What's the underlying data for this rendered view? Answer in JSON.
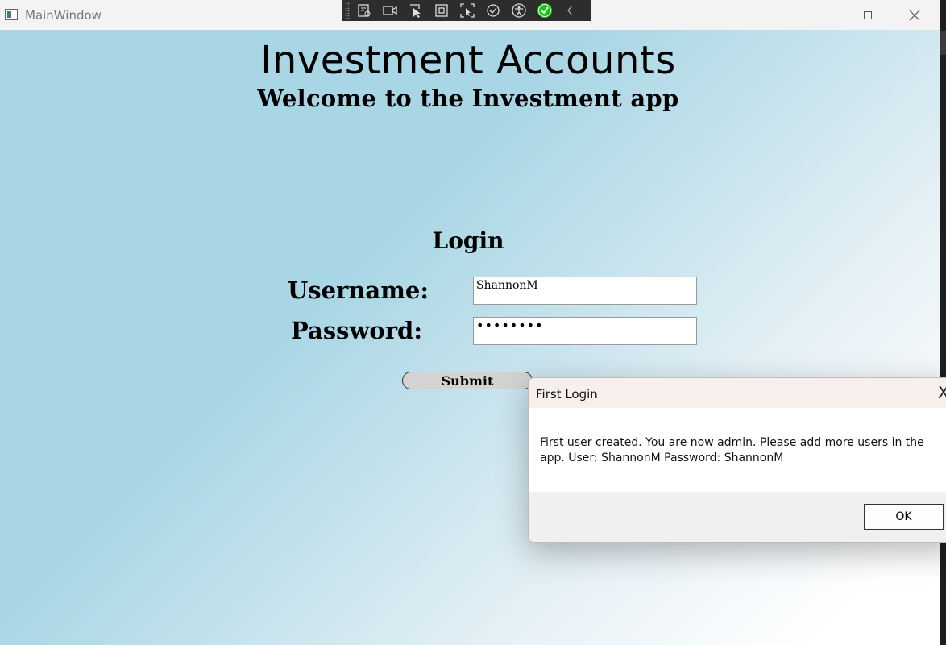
{
  "window": {
    "title": "MainWindow"
  },
  "debug_toolbar": {
    "icons": [
      "live-visual-tree-icon",
      "record-icon",
      "select-element-icon",
      "display-layout-adorners-icon",
      "track-focus-icon",
      "hot-reload-icon",
      "accessibility-icon",
      "binding-check-icon",
      "collapse-chevron-icon"
    ]
  },
  "header": {
    "title": "Investment Accounts",
    "subtitle": "Welcome to the Investment app"
  },
  "login": {
    "title": "Login",
    "username_label": "Username:",
    "username_value": "ShannonM",
    "password_label": "Password:",
    "password_mask": "••••••••",
    "submit_label": "Submit"
  },
  "dialog": {
    "title": "First Login",
    "close_glyph": "X",
    "message": "First user created. You are now admin. Please add more users in the app. User: ShannonM Password: ShannonM",
    "ok_label": "OK"
  },
  "colors": {
    "background_start": "#a9d6e5",
    "background_end": "#ffffff",
    "button_bg": "#d3d3d3",
    "toolbar_bg": "#2d2d2d",
    "check_green": "#16c60c"
  }
}
